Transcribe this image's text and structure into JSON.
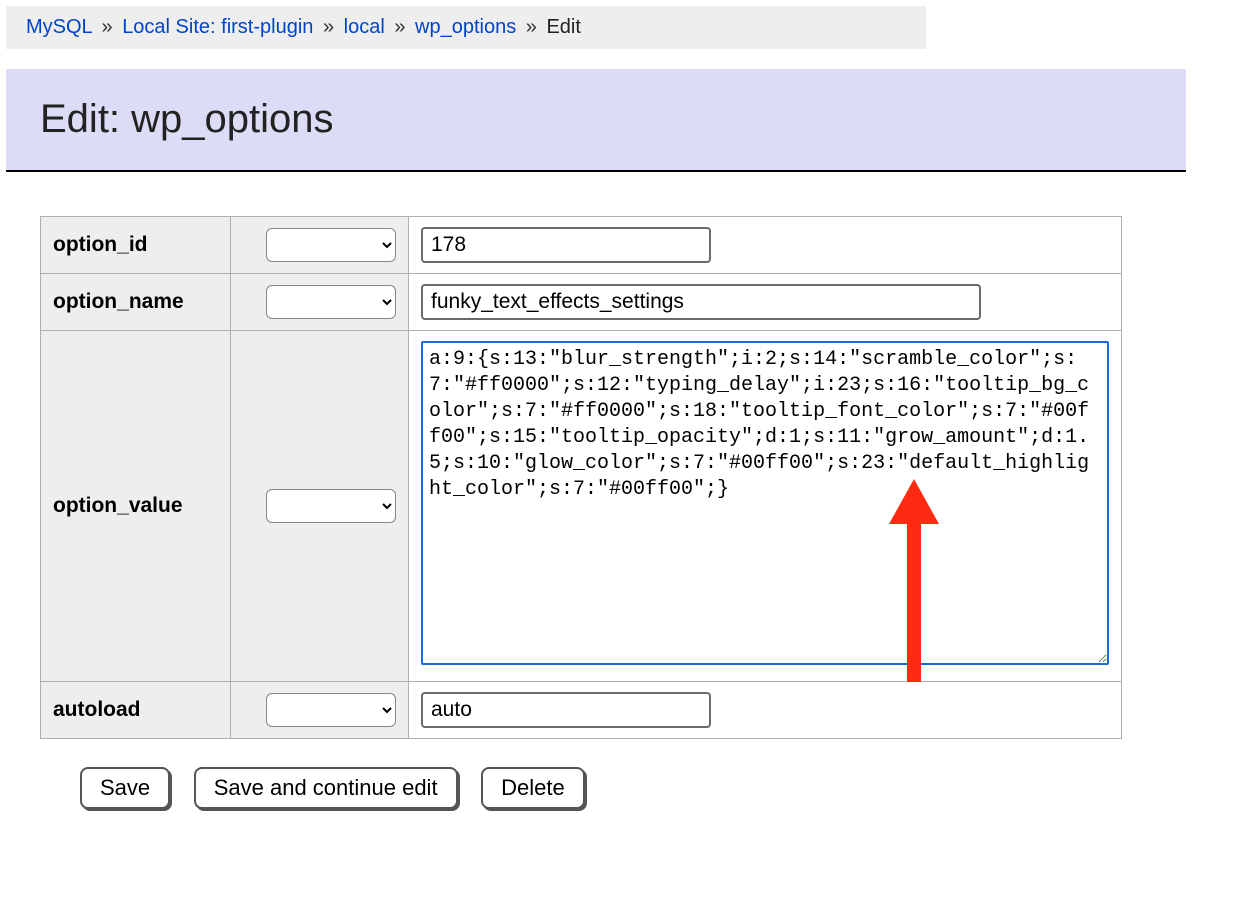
{
  "breadcrumb": {
    "items": [
      {
        "label": "MySQL",
        "href": true
      },
      {
        "label": "Local Site: first-plugin",
        "href": true
      },
      {
        "label": "local",
        "href": true
      },
      {
        "label": "wp_options",
        "href": true
      },
      {
        "label": "Edit",
        "href": false
      }
    ],
    "separator": "»"
  },
  "title": "Edit: wp_options",
  "rows": {
    "option_id": {
      "label": "option_id",
      "value": "178"
    },
    "option_name": {
      "label": "option_name",
      "value": "funky_text_effects_settings"
    },
    "option_value": {
      "label": "option_value",
      "value": "a:9:{s:13:\"blur_strength\";i:2;s:14:\"scramble_color\";s:7:\"#ff0000\";s:12:\"typing_delay\";i:23;s:16:\"tooltip_bg_color\";s:7:\"#ff0000\";s:18:\"tooltip_font_color\";s:7:\"#00ff00\";s:15:\"tooltip_opacity\";d:1;s:11:\"grow_amount\";d:1.5;s:10:\"glow_color\";s:7:\"#00ff00\";s:23:\"default_highlight_color\";s:7:\"#00ff00\";}"
    },
    "autoload": {
      "label": "autoload",
      "value": "auto"
    }
  },
  "buttons": {
    "save": "Save",
    "save_continue": "Save and continue edit",
    "delete": "Delete"
  },
  "annotation": {
    "arrow_color": "#ff2a12"
  }
}
